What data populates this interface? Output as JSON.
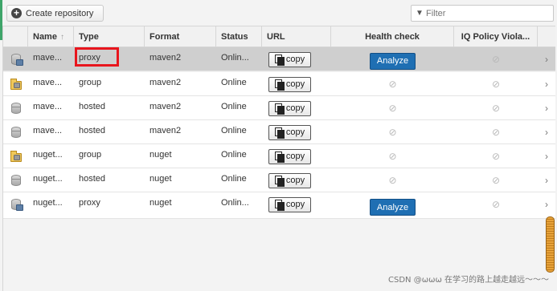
{
  "toolbar": {
    "create_label": "Create repository",
    "filter_placeholder": "Filter"
  },
  "columns": {
    "name": "Name",
    "type": "Type",
    "format": "Format",
    "status": "Status",
    "url": "URL",
    "health": "Health check",
    "iq": "IQ Policy Viola..."
  },
  "rows": [
    {
      "name": "mave...",
      "type": "proxy",
      "format": "maven2",
      "status": "Onlin...",
      "copy": "copy",
      "health": "Analyze",
      "icon": "proxy-repo-icon"
    },
    {
      "name": "mave...",
      "type": "group",
      "format": "maven2",
      "status": "Online",
      "copy": "copy",
      "health": "",
      "icon": "group-repo-icon"
    },
    {
      "name": "mave...",
      "type": "hosted",
      "format": "maven2",
      "status": "Online",
      "copy": "copy",
      "health": "",
      "icon": "hosted-repo-icon"
    },
    {
      "name": "mave...",
      "type": "hosted",
      "format": "maven2",
      "status": "Online",
      "copy": "copy",
      "health": "",
      "icon": "hosted-repo-icon"
    },
    {
      "name": "nuget...",
      "type": "group",
      "format": "nuget",
      "status": "Online",
      "copy": "copy",
      "health": "",
      "icon": "group-repo-icon"
    },
    {
      "name": "nuget...",
      "type": "hosted",
      "format": "nuget",
      "status": "Online",
      "copy": "copy",
      "health": "",
      "icon": "hosted-repo-icon"
    },
    {
      "name": "nuget...",
      "type": "proxy",
      "format": "nuget",
      "status": "Onlin...",
      "copy": "copy",
      "health": "Analyze",
      "icon": "proxy-repo-icon"
    }
  ],
  "watermark": "CSDN @ωωω 在学习的路上越走越远～～～",
  "colors": {
    "analyze": "#1f6fb3",
    "highlight": "#e8151d",
    "selected_row": "#cfcfcf"
  }
}
